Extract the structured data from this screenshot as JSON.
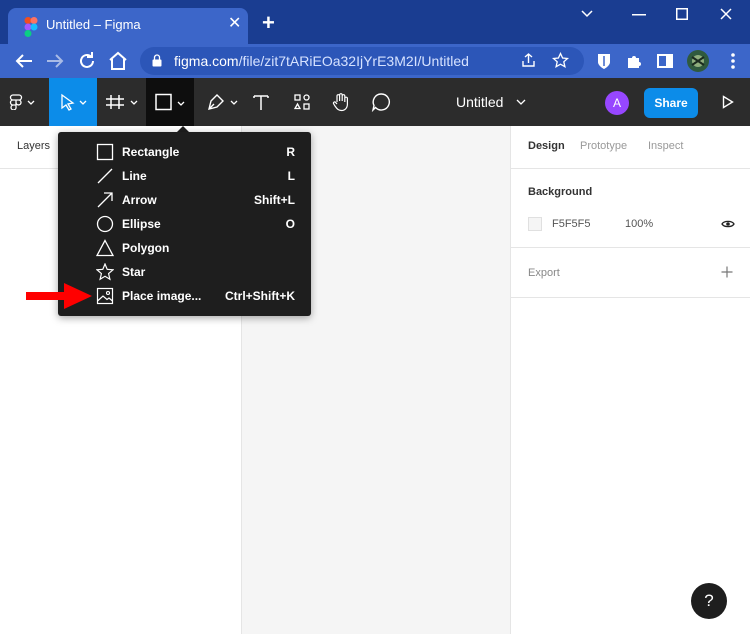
{
  "browser": {
    "tab_title": "Untitled – Figma",
    "new_tab_glyph": "+",
    "close_glyph": "✕",
    "url_host": "figma.com",
    "url_path": "/file/zit7tARiEOa32IjYrE3M2I/Untitled"
  },
  "toolbar": {
    "doc_title": "Untitled",
    "avatar_initial": "A",
    "share_label": "Share"
  },
  "left_panel": {
    "header": "Layers"
  },
  "right_panel": {
    "tabs": [
      "Design",
      "Prototype",
      "Inspect"
    ],
    "background_title": "Background",
    "bg_hex": "F5F5F5",
    "bg_opacity": "100%",
    "export_title": "Export"
  },
  "shape_menu": {
    "items": [
      {
        "label": "Rectangle",
        "shortcut": "R"
      },
      {
        "label": "Line",
        "shortcut": "L"
      },
      {
        "label": "Arrow",
        "shortcut": "Shift+L"
      },
      {
        "label": "Ellipse",
        "shortcut": "O"
      },
      {
        "label": "Polygon",
        "shortcut": ""
      },
      {
        "label": "Star",
        "shortcut": ""
      },
      {
        "label": "Place image...",
        "shortcut": "Ctrl+Shift+K"
      }
    ]
  },
  "help_label": "?",
  "colors": {
    "chrome_title": "#1a3d91",
    "chrome_toolbar": "#3c66c9",
    "figma_toolbar": "#2c2c2c",
    "figma_blue": "#0c8ce9",
    "menu_bg": "#1e1e1e",
    "canvas": "#f5f5f5",
    "annotation_arrow": "#ff0000"
  }
}
